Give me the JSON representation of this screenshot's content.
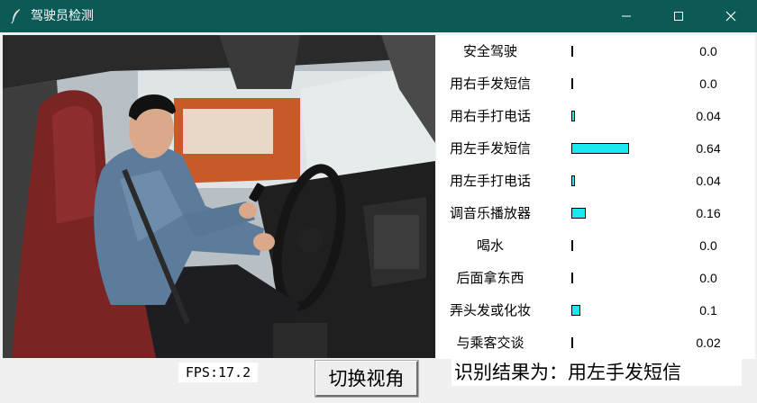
{
  "window": {
    "title": "驾驶员检测",
    "icon": "feather-icon",
    "accent": "#0b5a55"
  },
  "classes": [
    {
      "label": "安全驾驶",
      "value": "0.0",
      "prob": 0.0
    },
    {
      "label": "用右手发短信",
      "value": "0.0",
      "prob": 0.0
    },
    {
      "label": "用右手打电话",
      "value": "0.04",
      "prob": 0.04
    },
    {
      "label": "用左手发短信",
      "value": "0.64",
      "prob": 0.64
    },
    {
      "label": "用左手打电话",
      "value": "0.04",
      "prob": 0.04
    },
    {
      "label": "调音乐播放器",
      "value": "0.16",
      "prob": 0.16
    },
    {
      "label": "喝水",
      "value": "0.0",
      "prob": 0.0
    },
    {
      "label": "后面拿东西",
      "value": "0.0",
      "prob": 0.0
    },
    {
      "label": "弄头发或化妆",
      "value": "0.1",
      "prob": 0.1
    },
    {
      "label": "与乘客交谈",
      "value": "0.02",
      "prob": 0.02
    }
  ],
  "bar_color": "#1ce8ef",
  "fps": "FPS:17.2",
  "switch_button": "切换视角",
  "result": "识别结果为：用左手发短信"
}
